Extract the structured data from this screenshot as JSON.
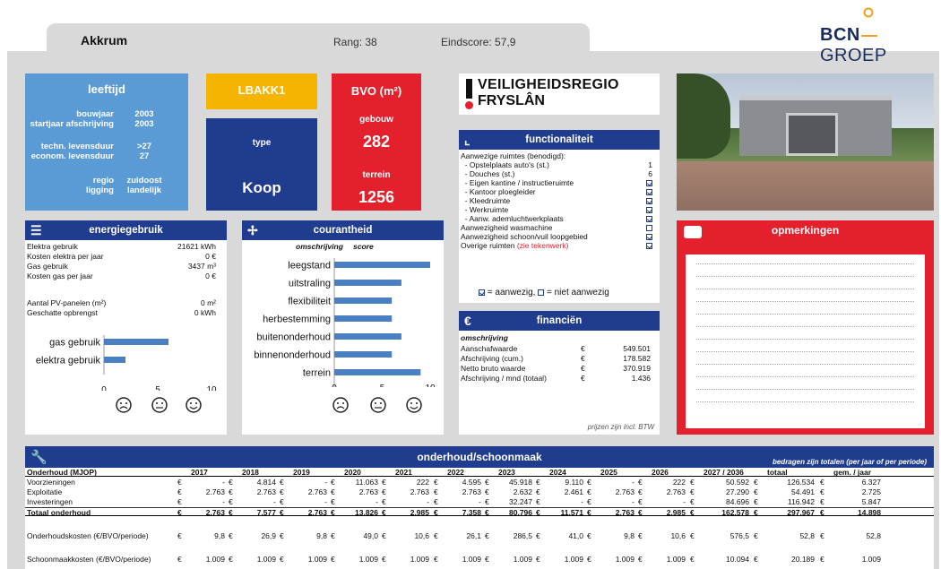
{
  "header": {
    "name": "Akkrum",
    "rang": "Rang: 38",
    "eindscore": "Eindscore: 57,9"
  },
  "logo": {
    "part1": "BCN",
    "part2": "GROEP"
  },
  "leeftijd": {
    "title": "leeftijd",
    "rows": [
      {
        "k": "bouwjaar",
        "v": "2003"
      },
      {
        "k": "startjaar afschrijving",
        "v": "2003"
      },
      {
        "k": "techn. levensduur",
        "v": ">27"
      },
      {
        "k": "econom. levensduur",
        "v": "27"
      },
      {
        "k": "regio",
        "v": "zuidoost"
      },
      {
        "k": "ligging",
        "v": "landelijk"
      }
    ]
  },
  "code": "LBAKK1",
  "type": {
    "label": "type",
    "value": "Koop"
  },
  "bvo": {
    "title": "BVO (m²)",
    "gebouw_label": "gebouw",
    "gebouw": "282",
    "terrein_label": "terrein",
    "terrein": "1256"
  },
  "veiligheidsregio": {
    "line1": "VEILIGHEIDSREGIO",
    "line2": "FRYSLÂN"
  },
  "functionaliteit": {
    "title": "functionaliteit",
    "items": [
      {
        "label": "Aanwezige ruimtes (benodigd):",
        "value": ""
      },
      {
        "label": "  - Opstelplaats auto's (st.)",
        "value": "1"
      },
      {
        "label": "  - Douches (st.)",
        "value": "6"
      },
      {
        "label": "  - Eigen kantine / instructieruimte",
        "value": "check"
      },
      {
        "label": "  - Kantoor ploegleider",
        "value": "check"
      },
      {
        "label": "  - Kleedruimte",
        "value": "check"
      },
      {
        "label": "  - Werkruimte",
        "value": "check"
      },
      {
        "label": "  - Aanw. ademluchtwerkplaats",
        "value": "check"
      },
      {
        "label": "Aanwezigheid wasmachine",
        "value": "empty"
      },
      {
        "label": "Aanwezigheid schoon/vuil loopgebied",
        "value": "check"
      },
      {
        "label": "Overige ruimten",
        "value": "check"
      }
    ],
    "overige_note": "(zie tekenwerk)",
    "legend_on": "= aanwezig,",
    "legend_off": "= niet aanwezig"
  },
  "financien": {
    "title": "financiën",
    "sub": "omschrijving",
    "rows": [
      {
        "k": "Aanschafwaarde",
        "c": "€",
        "v": "549.501"
      },
      {
        "k": "Afschrijving (cum.)",
        "c": "€",
        "v": "178.582"
      },
      {
        "k": "Netto bruto waarde",
        "c": "€",
        "v": "370.919"
      },
      {
        "k": "Afschrijving / mnd (totaal)",
        "c": "€",
        "v": "1.436"
      }
    ],
    "footer": "prijzen zijn incl. BTW"
  },
  "energie": {
    "title": "energiegebruik",
    "rows": [
      {
        "k": "Elektra gebruik",
        "v": "21621 kWh"
      },
      {
        "k": "Kosten elektra per jaar",
        "v": "0 €"
      },
      {
        "k": "Gas gebruik",
        "v": "3437 m³"
      },
      {
        "k": "Kosten gas per jaar",
        "v": "0 €"
      },
      {
        "k": "Aantal PV-panelen (m²)",
        "v": "0 m²"
      },
      {
        "k": "Geschatte opbrengst",
        "v": "0 kWh"
      }
    ]
  },
  "courantheid": {
    "title": "courantheid",
    "sub1": "omschrijving",
    "sub2": "score"
  },
  "opmerkingen": {
    "title": "opmerkingen"
  },
  "onderhoud": {
    "title": "onderhoud/schoonmaak",
    "note": "bedragen zijn totalen (per jaar of per periode)",
    "label_col": "Onderhoud (MJOP)",
    "years": [
      "2017",
      "2018",
      "2019",
      "2020",
      "2021",
      "2022",
      "2023",
      "2024",
      "2025",
      "2026",
      "2027 / 2036",
      "totaal",
      "gem. / jaar"
    ],
    "rows": [
      {
        "label": "Voorzieningen",
        "vals": [
          "-",
          "4.814",
          "-",
          "11.063",
          "222",
          "4.595",
          "45.918",
          "9.110",
          "-",
          "222",
          "50.592",
          "126.534",
          "6.327"
        ]
      },
      {
        "label": "Exploitatie",
        "vals": [
          "2.763",
          "2.763",
          "2.763",
          "2.763",
          "2.763",
          "2.763",
          "2.632",
          "2.461",
          "2.763",
          "2.763",
          "27.290",
          "54.491",
          "2.725"
        ]
      },
      {
        "label": "Investeringen",
        "vals": [
          "-",
          "-",
          "-",
          "-",
          "-",
          "-",
          "32.247",
          "-",
          "-",
          "-",
          "84.696",
          "116.942",
          "5.847"
        ]
      },
      {
        "label": "Totaal onderhoud",
        "vals": [
          "2.763",
          "7.577",
          "2.763",
          "13.826",
          "2.985",
          "7.358",
          "80.796",
          "11.571",
          "2.763",
          "2.985",
          "162.578",
          "297.967",
          "14.898"
        ]
      },
      {
        "label": "Onderhoudskosten (€/BVO/periode)",
        "vals": [
          "9,8",
          "26,9",
          "9,8",
          "49,0",
          "10,6",
          "26,1",
          "286,5",
          "41,0",
          "9,8",
          "10,6",
          "576,5",
          "52,8",
          "52,8"
        ]
      },
      {
        "label": "Schoonmaakkosten (€/BVO/periode)",
        "vals": [
          "1.009",
          "1.009",
          "1.009",
          "1.009",
          "1.009",
          "1.009",
          "1.009",
          "1.009",
          "1.009",
          "1.009",
          "10.094",
          "20.189",
          "1.009"
        ]
      }
    ]
  },
  "chart_data": [
    {
      "type": "bar",
      "orientation": "horizontal",
      "categories": [
        "gas gebruik",
        "elektra gebruik"
      ],
      "values": [
        6,
        2
      ],
      "xlim": [
        0,
        10
      ],
      "xticks": [
        "0",
        "5",
        "10"
      ],
      "color": "#4a7fc1"
    },
    {
      "type": "bar",
      "orientation": "horizontal",
      "categories": [
        "leegstand",
        "uitstraling",
        "flexibiliteit",
        "herbestemming",
        "buitenonderhoud",
        "binnenonderhoud",
        "terrein"
      ],
      "values": [
        10,
        7,
        6,
        6,
        7,
        6,
        9
      ],
      "xlim": [
        0,
        10
      ],
      "xticks": [
        "0",
        "5",
        "10"
      ],
      "color": "#4a7fc1"
    }
  ]
}
